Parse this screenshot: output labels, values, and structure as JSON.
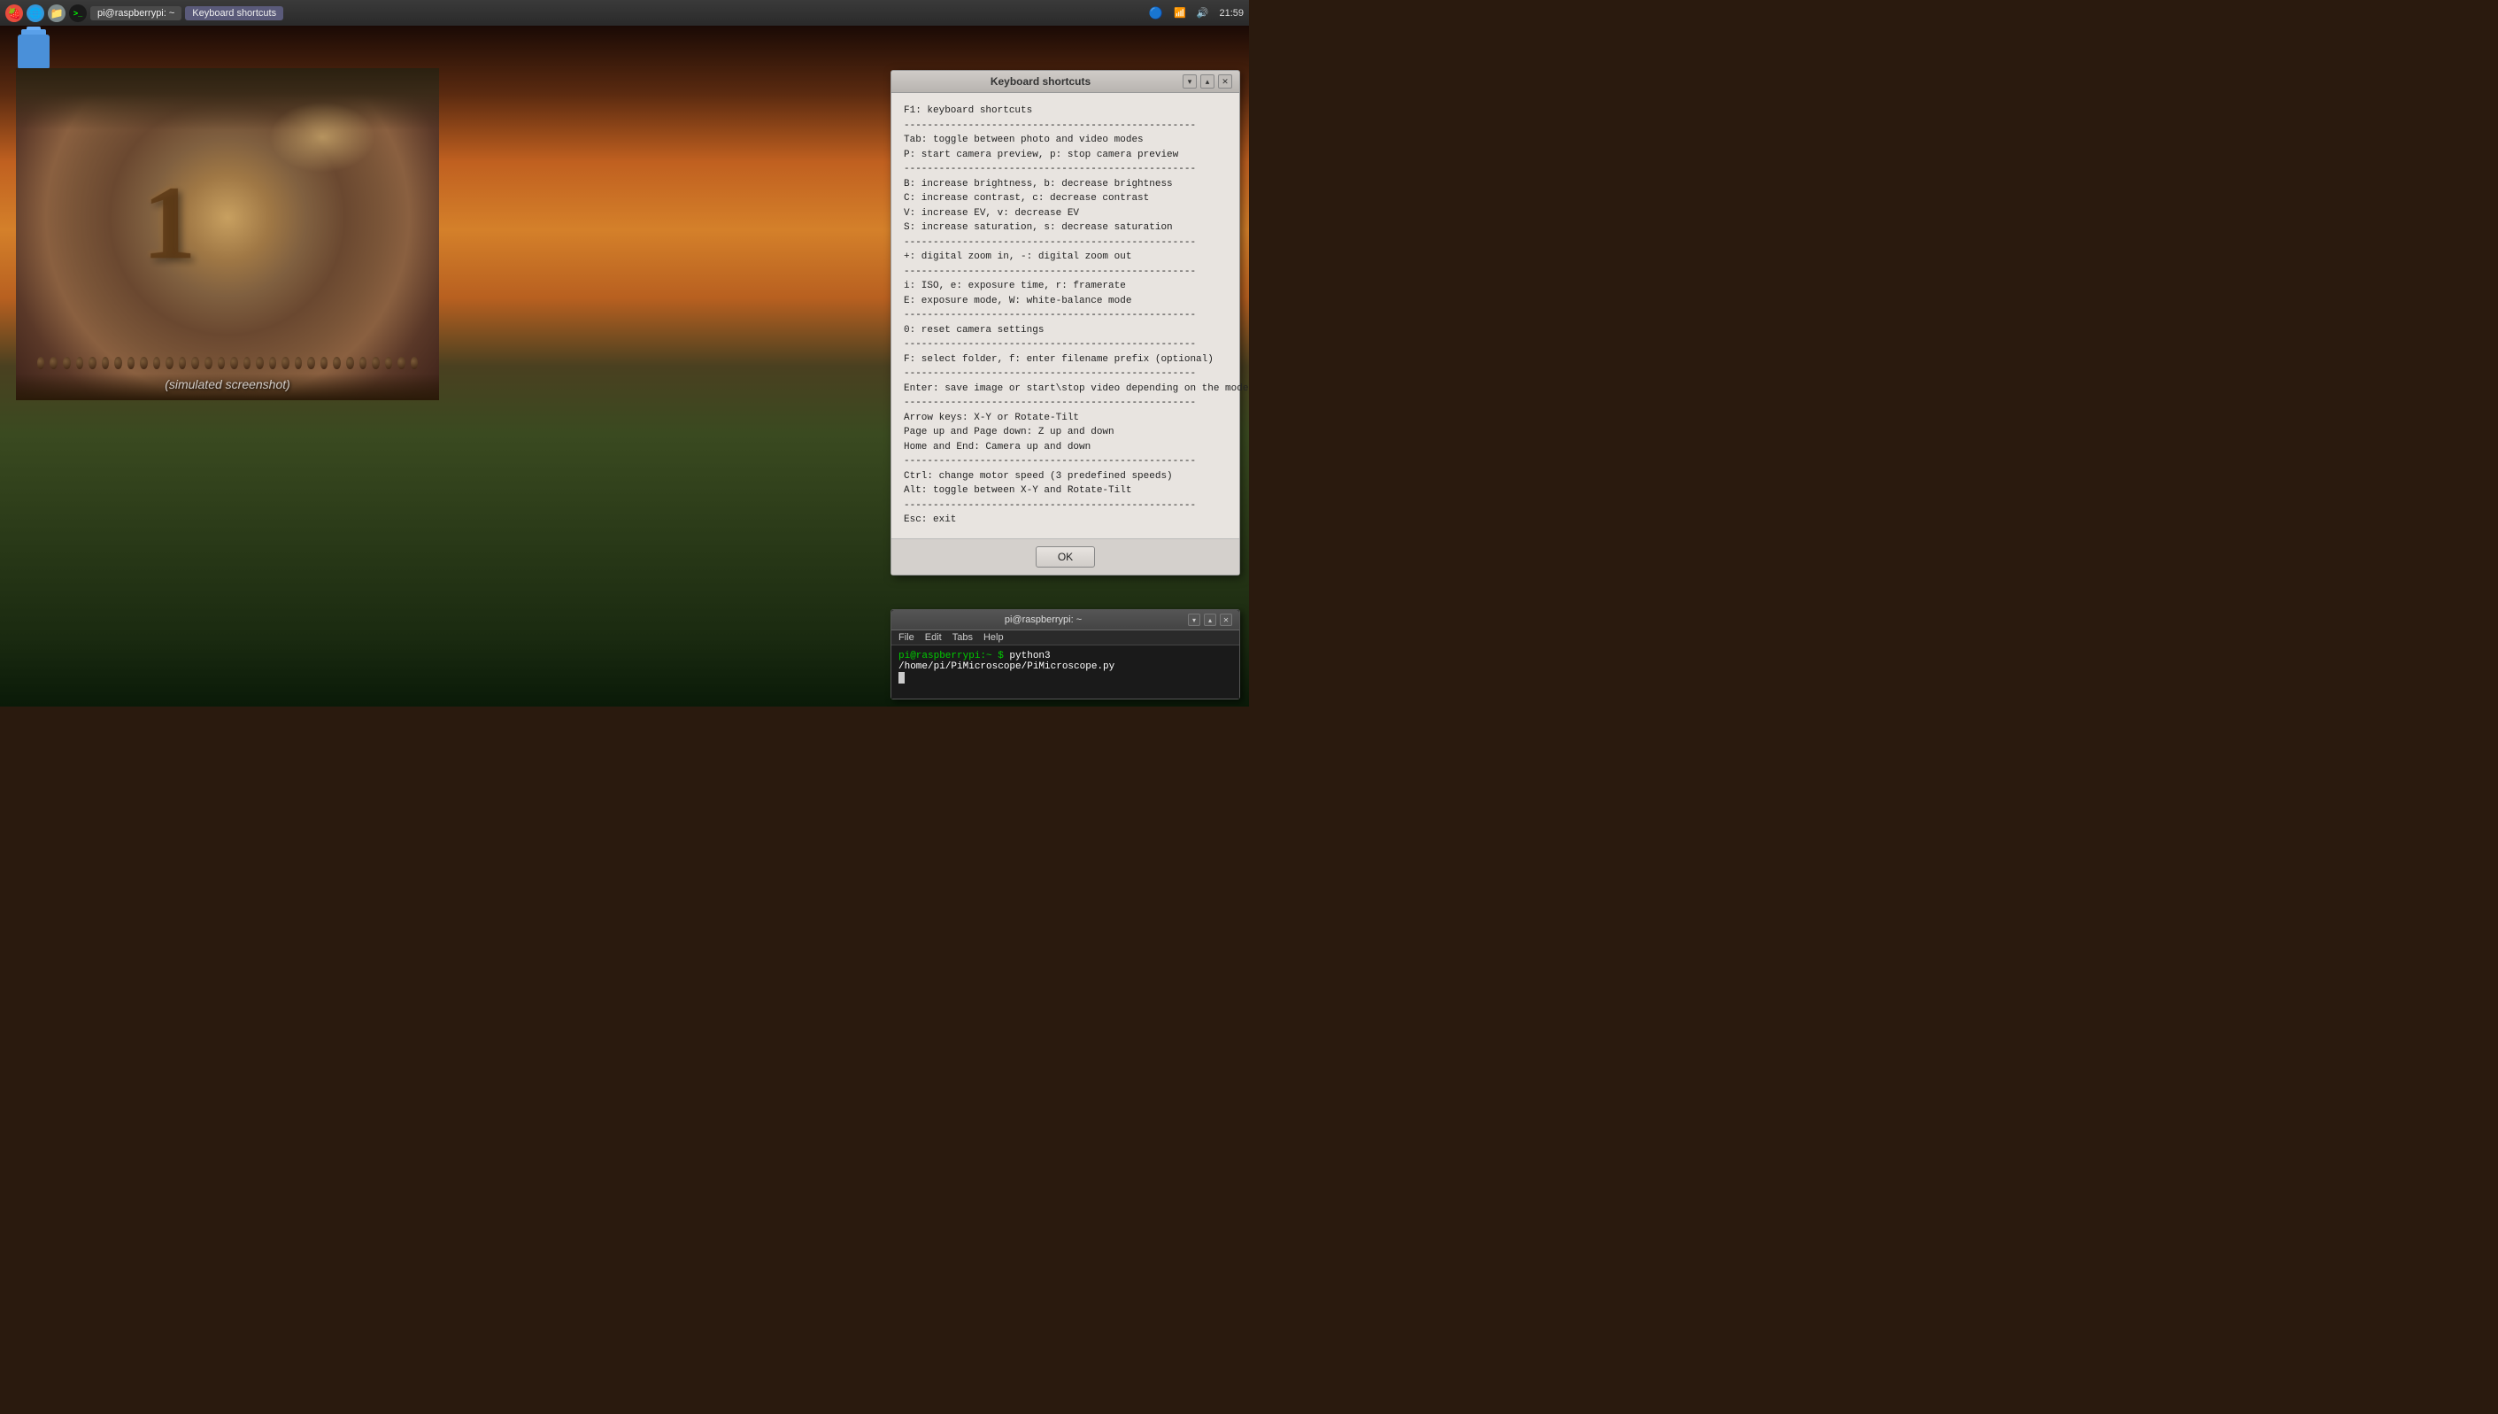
{
  "taskbar": {
    "items": [
      {
        "id": "raspberry",
        "label": "🍓",
        "type": "icon"
      },
      {
        "id": "browser",
        "label": "🌐",
        "type": "icon"
      },
      {
        "id": "files",
        "label": "📁",
        "type": "icon"
      },
      {
        "id": "terminal1",
        "label": "pi@raspberrypi: ~",
        "type": "window"
      },
      {
        "id": "kbd_shortcuts",
        "label": "Keyboard shortcuts",
        "type": "window",
        "active": true
      }
    ],
    "right": {
      "bluetooth": "🔵",
      "network": "📶",
      "volume": "🔊",
      "time": "21:59"
    }
  },
  "trash": {
    "label": "Trash"
  },
  "camera_preview": {
    "simulated_text": "(simulated screenshot)"
  },
  "kbd_dialog": {
    "title": "Keyboard shortcuts",
    "content": "F1: keyboard shortcuts\n--------------------------------------------------\nTab: toggle between photo and video modes\nP: start camera preview, p: stop camera preview\n--------------------------------------------------\nB: increase brightness, b: decrease brightness\nC: increase contrast, c: decrease contrast\nV: increase EV, v: decrease EV\nS: increase saturation, s: decrease saturation\n--------------------------------------------------\n+: digital zoom in, -: digital zoom out\n--------------------------------------------------\ni: ISO, e: exposure time, r: framerate\nE: exposure mode, W: white-balance mode\n--------------------------------------------------\n0: reset camera settings\n--------------------------------------------------\nF: select folder, f: enter filename prefix (optional)\n--------------------------------------------------\nEnter: save image or start\\stop video depending on the mode\n--------------------------------------------------\nArrow keys: X-Y or Rotate-Tilt\nPage up and Page down: Z up and down\nHome and End: Camera up and down\n--------------------------------------------------\nCtrl: change motor speed (3 predefined speeds)\nAlt: toggle between X-Y and Rotate-Tilt\n--------------------------------------------------\nEsc: exit",
    "ok_button": "OK",
    "controls": {
      "minimize": "▾",
      "maximize": "▴",
      "close": "✕"
    }
  },
  "terminal": {
    "title": "pi@raspberrypi: ~",
    "menu": [
      "File",
      "Edit",
      "Tabs",
      "Help"
    ],
    "prompt": "pi@raspberrypi:~ $",
    "command": " python3 /home/pi/PiMicroscope/PiMicroscope.py",
    "controls": {
      "minimize": "▾",
      "maximize": "▴",
      "close": "✕"
    }
  }
}
